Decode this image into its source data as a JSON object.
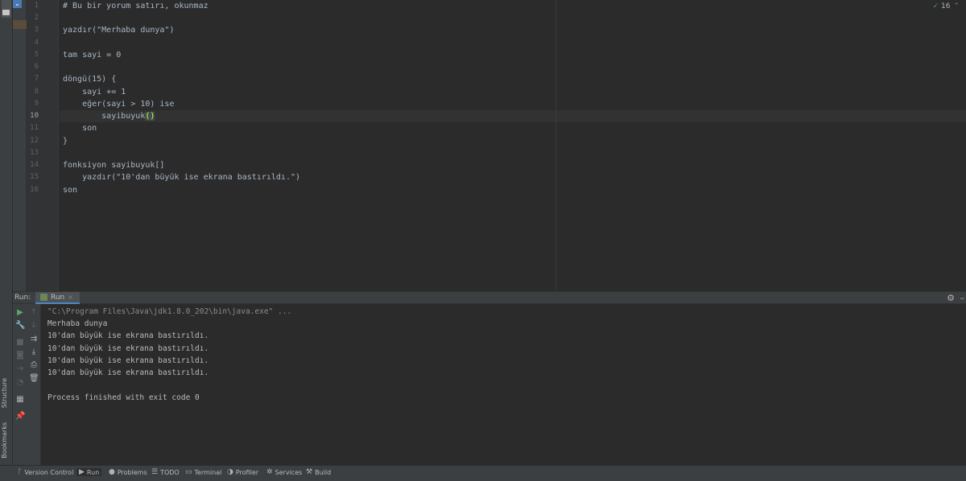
{
  "left_strip": {
    "tabs": [
      "Project",
      "Structure",
      "Bookmarks"
    ]
  },
  "editor": {
    "line_numbers": [
      "1",
      "2",
      "3",
      "4",
      "5",
      "6",
      "7",
      "8",
      "9",
      "10",
      "11",
      "12",
      "13",
      "14",
      "15",
      "16"
    ],
    "active_line": "10",
    "lines": [
      "# Bu bir yorum satırı, okunmaz",
      "",
      "yazdır(\"Merhaba dunya\")",
      "",
      "tam sayi = 0",
      "",
      "döngü(15) {",
      "    sayi += 1",
      "    eğer(sayi > 10) ise",
      "        sayibuyuk",
      "    son",
      "}",
      "",
      "fonksiyon sayibuyuk[]",
      "    yazdır(\"10'dan büyük ise ekrana bastırıldı.\")",
      "son"
    ],
    "line10_suffix": "()",
    "inspection_count": "16"
  },
  "run_panel": {
    "label": "Run:",
    "tab_label": "Run",
    "tab_close": "×",
    "console_lines": [
      "\"C:\\Program Files\\Java\\jdk1.8.0_202\\bin\\java.exe\" ...",
      "Merhaba dunya",
      "10'dan büyük ise ekrana bastırıldı.",
      "10'dan büyük ise ekrana bastırıldı.",
      "10'dan büyük ise ekrana bastırıldı.",
      "10'dan büyük ise ekrana bastırıldı.",
      "",
      "Process finished with exit code 0"
    ]
  },
  "bottom_bar": {
    "items": [
      "Version Control",
      "Run",
      "Problems",
      "TODO",
      "Terminal",
      "Profiler",
      "Services",
      "Build"
    ],
    "active": "Run"
  },
  "colors": {
    "background": "#2b2b2b",
    "panel": "#3c3f41",
    "accent": "#4a88c7",
    "run_green": "#59a869"
  }
}
